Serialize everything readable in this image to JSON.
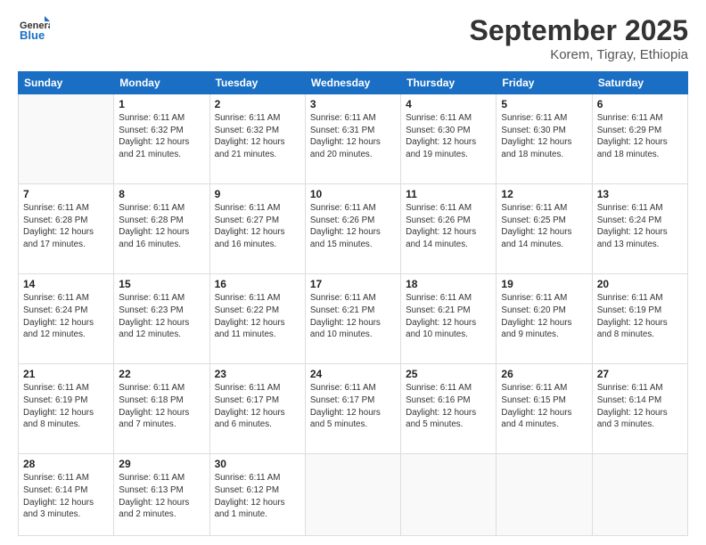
{
  "logo": {
    "line1": "General",
    "line2": "Blue"
  },
  "title": "September 2025",
  "subtitle": "Korem, Tigray, Ethiopia",
  "weekdays": [
    "Sunday",
    "Monday",
    "Tuesday",
    "Wednesday",
    "Thursday",
    "Friday",
    "Saturday"
  ],
  "weeks": [
    [
      {
        "day": "",
        "info": ""
      },
      {
        "day": "1",
        "info": "Sunrise: 6:11 AM\nSunset: 6:32 PM\nDaylight: 12 hours\nand 21 minutes."
      },
      {
        "day": "2",
        "info": "Sunrise: 6:11 AM\nSunset: 6:32 PM\nDaylight: 12 hours\nand 21 minutes."
      },
      {
        "day": "3",
        "info": "Sunrise: 6:11 AM\nSunset: 6:31 PM\nDaylight: 12 hours\nand 20 minutes."
      },
      {
        "day": "4",
        "info": "Sunrise: 6:11 AM\nSunset: 6:30 PM\nDaylight: 12 hours\nand 19 minutes."
      },
      {
        "day": "5",
        "info": "Sunrise: 6:11 AM\nSunset: 6:30 PM\nDaylight: 12 hours\nand 18 minutes."
      },
      {
        "day": "6",
        "info": "Sunrise: 6:11 AM\nSunset: 6:29 PM\nDaylight: 12 hours\nand 18 minutes."
      }
    ],
    [
      {
        "day": "7",
        "info": "Sunrise: 6:11 AM\nSunset: 6:28 PM\nDaylight: 12 hours\nand 17 minutes."
      },
      {
        "day": "8",
        "info": "Sunrise: 6:11 AM\nSunset: 6:28 PM\nDaylight: 12 hours\nand 16 minutes."
      },
      {
        "day": "9",
        "info": "Sunrise: 6:11 AM\nSunset: 6:27 PM\nDaylight: 12 hours\nand 16 minutes."
      },
      {
        "day": "10",
        "info": "Sunrise: 6:11 AM\nSunset: 6:26 PM\nDaylight: 12 hours\nand 15 minutes."
      },
      {
        "day": "11",
        "info": "Sunrise: 6:11 AM\nSunset: 6:26 PM\nDaylight: 12 hours\nand 14 minutes."
      },
      {
        "day": "12",
        "info": "Sunrise: 6:11 AM\nSunset: 6:25 PM\nDaylight: 12 hours\nand 14 minutes."
      },
      {
        "day": "13",
        "info": "Sunrise: 6:11 AM\nSunset: 6:24 PM\nDaylight: 12 hours\nand 13 minutes."
      }
    ],
    [
      {
        "day": "14",
        "info": "Sunrise: 6:11 AM\nSunset: 6:24 PM\nDaylight: 12 hours\nand 12 minutes."
      },
      {
        "day": "15",
        "info": "Sunrise: 6:11 AM\nSunset: 6:23 PM\nDaylight: 12 hours\nand 12 minutes."
      },
      {
        "day": "16",
        "info": "Sunrise: 6:11 AM\nSunset: 6:22 PM\nDaylight: 12 hours\nand 11 minutes."
      },
      {
        "day": "17",
        "info": "Sunrise: 6:11 AM\nSunset: 6:21 PM\nDaylight: 12 hours\nand 10 minutes."
      },
      {
        "day": "18",
        "info": "Sunrise: 6:11 AM\nSunset: 6:21 PM\nDaylight: 12 hours\nand 10 minutes."
      },
      {
        "day": "19",
        "info": "Sunrise: 6:11 AM\nSunset: 6:20 PM\nDaylight: 12 hours\nand 9 minutes."
      },
      {
        "day": "20",
        "info": "Sunrise: 6:11 AM\nSunset: 6:19 PM\nDaylight: 12 hours\nand 8 minutes."
      }
    ],
    [
      {
        "day": "21",
        "info": "Sunrise: 6:11 AM\nSunset: 6:19 PM\nDaylight: 12 hours\nand 8 minutes."
      },
      {
        "day": "22",
        "info": "Sunrise: 6:11 AM\nSunset: 6:18 PM\nDaylight: 12 hours\nand 7 minutes."
      },
      {
        "day": "23",
        "info": "Sunrise: 6:11 AM\nSunset: 6:17 PM\nDaylight: 12 hours\nand 6 minutes."
      },
      {
        "day": "24",
        "info": "Sunrise: 6:11 AM\nSunset: 6:17 PM\nDaylight: 12 hours\nand 5 minutes."
      },
      {
        "day": "25",
        "info": "Sunrise: 6:11 AM\nSunset: 6:16 PM\nDaylight: 12 hours\nand 5 minutes."
      },
      {
        "day": "26",
        "info": "Sunrise: 6:11 AM\nSunset: 6:15 PM\nDaylight: 12 hours\nand 4 minutes."
      },
      {
        "day": "27",
        "info": "Sunrise: 6:11 AM\nSunset: 6:14 PM\nDaylight: 12 hours\nand 3 minutes."
      }
    ],
    [
      {
        "day": "28",
        "info": "Sunrise: 6:11 AM\nSunset: 6:14 PM\nDaylight: 12 hours\nand 3 minutes."
      },
      {
        "day": "29",
        "info": "Sunrise: 6:11 AM\nSunset: 6:13 PM\nDaylight: 12 hours\nand 2 minutes."
      },
      {
        "day": "30",
        "info": "Sunrise: 6:11 AM\nSunset: 6:12 PM\nDaylight: 12 hours\nand 1 minute."
      },
      {
        "day": "",
        "info": ""
      },
      {
        "day": "",
        "info": ""
      },
      {
        "day": "",
        "info": ""
      },
      {
        "day": "",
        "info": ""
      }
    ]
  ]
}
